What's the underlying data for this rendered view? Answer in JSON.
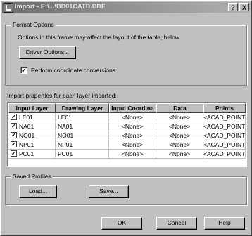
{
  "window": {
    "title": "Import - E:\\...\\BD01CATD.DDF",
    "help_btn": "?",
    "close_btn": "X"
  },
  "format_options": {
    "group_title": "Format Options",
    "description": "Options in this frame may affect the layout of the table, below.",
    "driver_button": "Driver Options...",
    "perform_conversion_label": "Perform coordinate conversions",
    "perform_conversion_checked": true
  },
  "layers": {
    "heading": "Import properties for each layer imported:",
    "columns": [
      "Input Layer",
      "Drawing Layer",
      "Input Coordina",
      "Data",
      "Points"
    ],
    "rows": [
      {
        "input": "LE01",
        "drawing": "LE01",
        "coord": "<None>",
        "data": "<None>",
        "points": "<ACAD_POINT>"
      },
      {
        "input": "NA01",
        "drawing": "NA01",
        "coord": "<None>",
        "data": "<None>",
        "points": "<ACAD_POINT>"
      },
      {
        "input": "NO01",
        "drawing": "NO01",
        "coord": "<None>",
        "data": "<None>",
        "points": "<ACAD_POINT>"
      },
      {
        "input": "NP01",
        "drawing": "NP01",
        "coord": "<None>",
        "data": "<None>",
        "points": "<ACAD_POINT>"
      },
      {
        "input": "PC01",
        "drawing": "PC01",
        "coord": "<None>",
        "data": "<None>",
        "points": "<ACAD_POINT>"
      }
    ]
  },
  "saved_profiles": {
    "group_title": "Saved Profiles",
    "load_button": "Load...",
    "save_button": "Save..."
  },
  "footer": {
    "ok": "OK",
    "cancel": "Cancel",
    "help": "Help"
  },
  "icons": {
    "check": "✓"
  }
}
